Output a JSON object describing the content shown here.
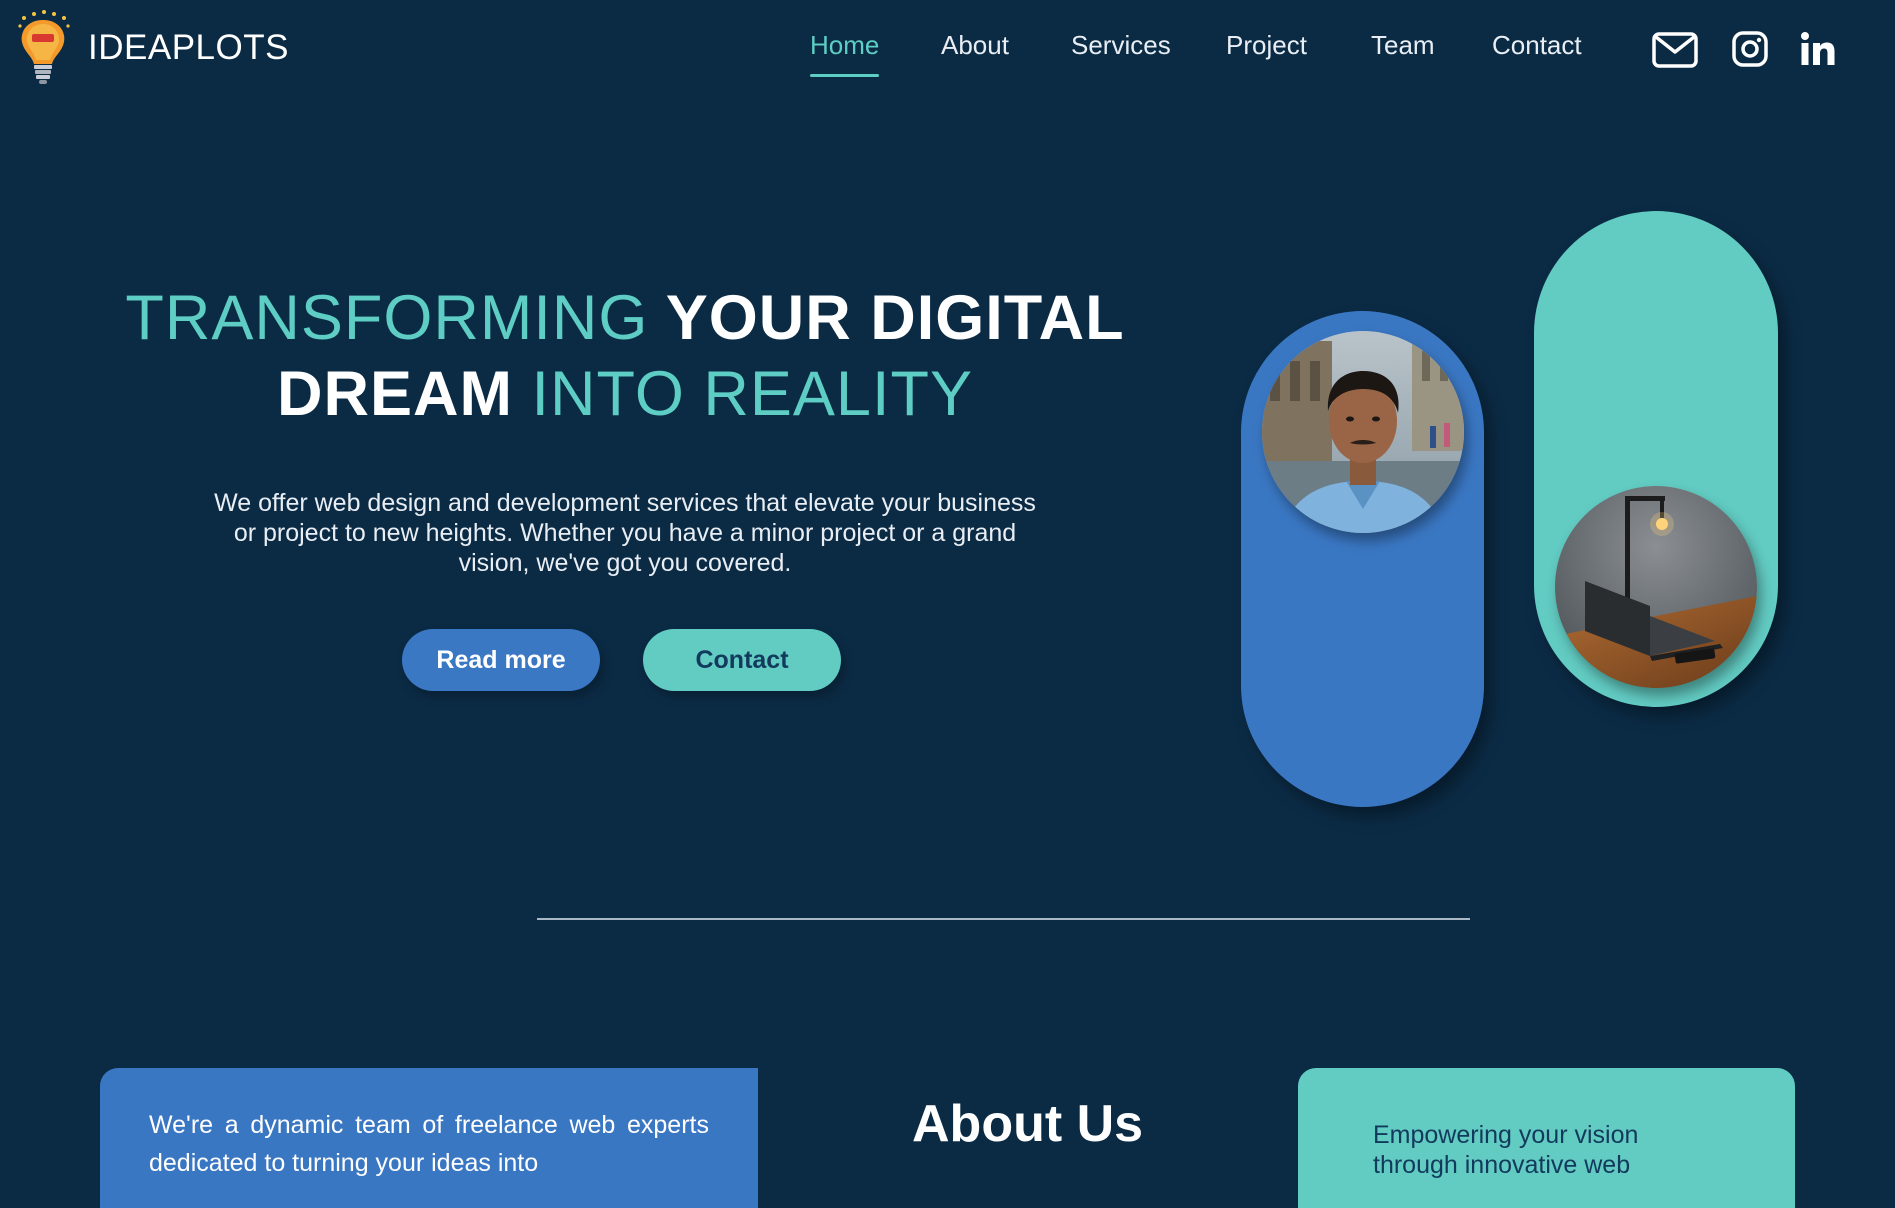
{
  "brand": {
    "name": "IDEAPLOTS"
  },
  "nav": {
    "items": [
      {
        "label": "Home",
        "active": true
      },
      {
        "label": "About"
      },
      {
        "label": "Services"
      },
      {
        "label": "Project"
      },
      {
        "label": "Team"
      },
      {
        "label": "Contact"
      }
    ]
  },
  "social": {
    "icons": [
      "mail-icon",
      "instagram-icon",
      "linkedin-icon"
    ]
  },
  "hero": {
    "title_part1": "TRANSFORMING",
    "title_part2": "YOUR DIGITAL",
    "title_part3": "DREAM",
    "title_part4": "INTO REALITY",
    "description": "We offer web design and development services that elevate your business or project to new heights. Whether you have a minor project or a grand vision, we've got you covered.",
    "read_more_label": "Read more",
    "contact_label": "Contact"
  },
  "about": {
    "heading_light": "About",
    "heading_bold": "Us",
    "left_text": "We're a dynamic team of freelance web experts dedicated to turning your ideas into",
    "right_text": "Empowering your vision through innovative web"
  },
  "colors": {
    "background": "#0b2b45",
    "accent_teal": "#5ecdc4",
    "accent_blue": "#3a77c3"
  }
}
